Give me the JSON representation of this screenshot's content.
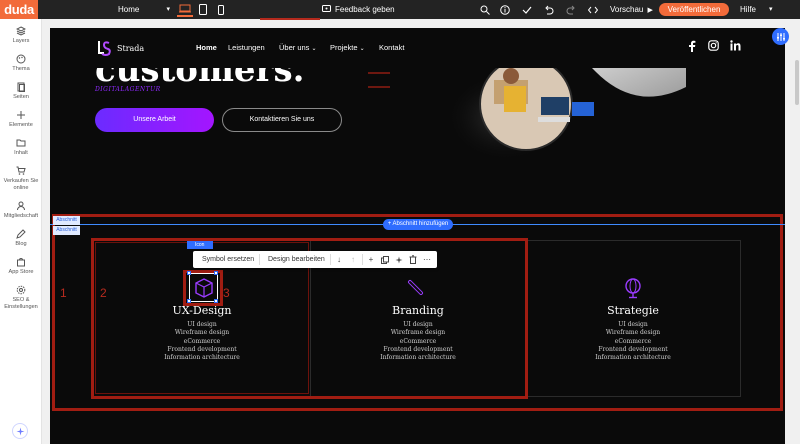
{
  "topbar": {
    "logo": "duda",
    "page": "Home",
    "feedback": "Feedback geben",
    "preview": "Vorschau",
    "publish": "Veröffentlichen",
    "help": "Hilfe"
  },
  "sidebar": {
    "items": [
      {
        "label": "Layers",
        "icon": "layers-icon"
      },
      {
        "label": "Thema",
        "icon": "palette-icon"
      },
      {
        "label": "Seiten",
        "icon": "pages-icon"
      },
      {
        "label": "Elemente",
        "icon": "plus-icon"
      },
      {
        "label": "Inhalt",
        "icon": "folder-icon"
      },
      {
        "label": "Verkaufen Sie online",
        "icon": "cart-icon"
      },
      {
        "label": "Mitgliedschaft",
        "icon": "user-icon"
      },
      {
        "label": "Blog",
        "icon": "blog-icon"
      },
      {
        "label": "App Store",
        "icon": "app-store-icon"
      },
      {
        "label": "SEO & Einstellungen",
        "icon": "settings-icon"
      }
    ]
  },
  "site": {
    "hero_partial": "customers.",
    "tagline": "DIGITALAGENTUR",
    "btn_primary": "Unsere Arbeit",
    "btn_secondary": "Kontaktieren Sie uns",
    "brand": "Strada",
    "nav": [
      "Home",
      "Leistungen",
      "Über uns",
      "Projekte",
      "Kontakt"
    ],
    "social": [
      "facebook-icon",
      "instagram-icon",
      "linkedin-icon"
    ]
  },
  "editor": {
    "section_label_1": "Abschnitt",
    "section_label_2": "Abschnitt",
    "add_section": "+ Abschnitt hinzufügen",
    "icon_tag": "Icon",
    "toolbar": {
      "replace_symbol": "Symbol ersetzen",
      "edit_design": "Design bearbeiten"
    },
    "column_numbers": [
      "1",
      "2",
      "3"
    ]
  },
  "columns": [
    {
      "title": "UX-Design",
      "items": [
        "UI design",
        "Wireframe design",
        "eCommerce",
        "Frontend development",
        "Information architecture"
      ]
    },
    {
      "title": "Branding",
      "items": [
        "UI design",
        "Wireframe design",
        "eCommerce",
        "Frontend development",
        "Information architecture"
      ]
    },
    {
      "title": "Strategie",
      "items": [
        "UI design",
        "Wireframe design",
        "eCommerce",
        "Frontend development",
        "Information architecture"
      ]
    }
  ],
  "colors": {
    "accent": "#f26b3a",
    "blue": "#2f6dff",
    "purple": "#8f2aff",
    "red": "#a11d12"
  }
}
